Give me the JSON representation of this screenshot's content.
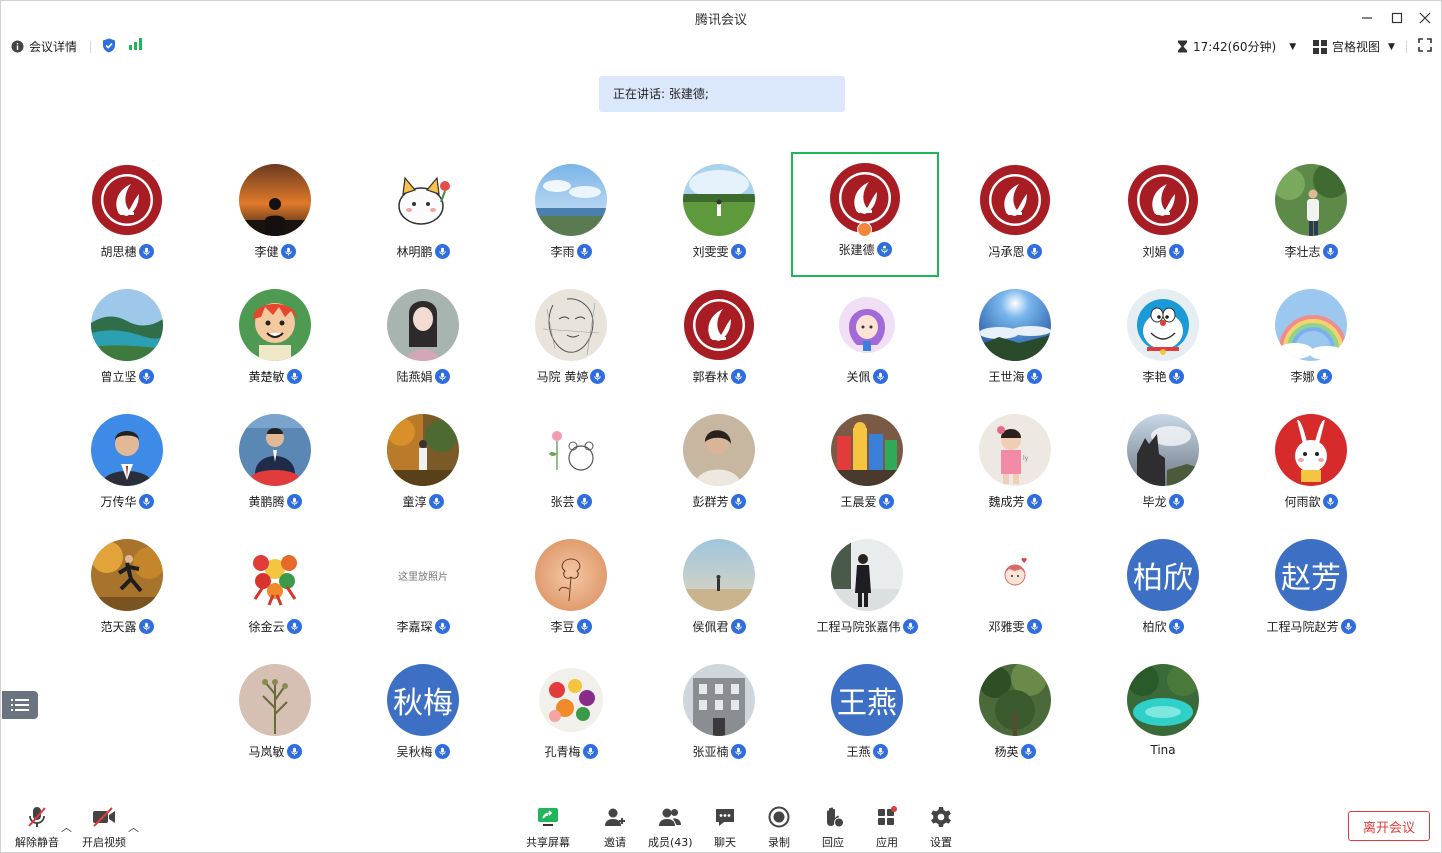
{
  "window": {
    "title": "腾讯会议"
  },
  "infobar": {
    "details_label": "会议详情",
    "time_label": "17:42(60分钟)",
    "view_label": "宫格视图"
  },
  "speaking": {
    "text": "正在讲话: 张建德;"
  },
  "colors": {
    "accent": "#2f6de0",
    "active_border": "#20b558",
    "leave": "#e23b3b",
    "text_avatar": "#3d70c4"
  },
  "participants": [
    {
      "name": "胡思穗",
      "avatar": "school-logo"
    },
    {
      "name": "李健",
      "avatar": "sunset-silhouette"
    },
    {
      "name": "林明鹏",
      "avatar": "cartoon-cat"
    },
    {
      "name": "李雨",
      "avatar": "sky-landscape"
    },
    {
      "name": "刘雯雯",
      "avatar": "green-field"
    },
    {
      "name": "张建德",
      "avatar": "school-logo",
      "active": true,
      "host": true
    },
    {
      "name": "冯承恩",
      "avatar": "school-logo"
    },
    {
      "name": "刘娟",
      "avatar": "school-logo"
    },
    {
      "name": "李壮志",
      "avatar": "person-in-trees"
    },
    {
      "name": "曾立坚",
      "avatar": "bay-landscape"
    },
    {
      "name": "黄楚敏",
      "avatar": "anime-character"
    },
    {
      "name": "陆燕娟",
      "avatar": "drawn-girl"
    },
    {
      "name": "马院 黄婷",
      "avatar": "sketch-face"
    },
    {
      "name": "郭春林",
      "avatar": "school-logo"
    },
    {
      "name": "关佩",
      "avatar": "cartoon-girl"
    },
    {
      "name": "王世海",
      "avatar": "blue-sky"
    },
    {
      "name": "李艳",
      "avatar": "doraemon"
    },
    {
      "name": "李娜",
      "avatar": "rainbow"
    },
    {
      "name": "万传华",
      "avatar": "man-portrait"
    },
    {
      "name": "黄鹏腾",
      "avatar": "man-suit"
    },
    {
      "name": "童淳",
      "avatar": "autumn-painting"
    },
    {
      "name": "张芸",
      "avatar": "flower-bear"
    },
    {
      "name": "彭群芳",
      "avatar": "person-photo"
    },
    {
      "name": "王晨爱",
      "avatar": "lego-toys"
    },
    {
      "name": "魏成芳",
      "avatar": "child-photo"
    },
    {
      "name": "毕龙",
      "avatar": "statue-clouds"
    },
    {
      "name": "何雨歆",
      "avatar": "rabbit-red"
    },
    {
      "name": "范天露",
      "avatar": "runner-autumn"
    },
    {
      "name": "徐金云",
      "avatar": "flower-art"
    },
    {
      "name": "李嘉琛",
      "avatar": "placeholder",
      "placeholder_text": "这里放照片"
    },
    {
      "name": "李豆",
      "avatar": "rose-drawing"
    },
    {
      "name": "侯佩君",
      "avatar": "beach-scene"
    },
    {
      "name": "工程马院张嘉伟",
      "avatar": "person-snow"
    },
    {
      "name": "邓雅雯",
      "avatar": "small-cartoon"
    },
    {
      "name": "柏欣",
      "avatar": "text",
      "avatar_text": "柏欣"
    },
    {
      "name": "工程马院赵芳",
      "avatar": "text",
      "avatar_text": "赵芳"
    },
    {
      "name": "马岚敏",
      "avatar": "dried-plant"
    },
    {
      "name": "吴秋梅",
      "avatar": "text",
      "avatar_text": "秋梅"
    },
    {
      "name": "孔青梅",
      "avatar": "fruit-plate"
    },
    {
      "name": "张亚楠",
      "avatar": "building"
    },
    {
      "name": "王燕",
      "avatar": "text",
      "avatar_text": "王燕"
    },
    {
      "name": "杨英",
      "avatar": "forest"
    },
    {
      "name": "Tina",
      "avatar": "turquoise-lake",
      "no_mic": true
    }
  ],
  "toolbar": {
    "unmute": "解除静音",
    "start_video": "开启视频",
    "share": "共享屏幕",
    "invite": "邀请",
    "members": "成员(43)",
    "chat": "聊天",
    "record": "录制",
    "reactions": "回应",
    "apps": "应用",
    "settings": "设置",
    "leave": "离开会议"
  }
}
